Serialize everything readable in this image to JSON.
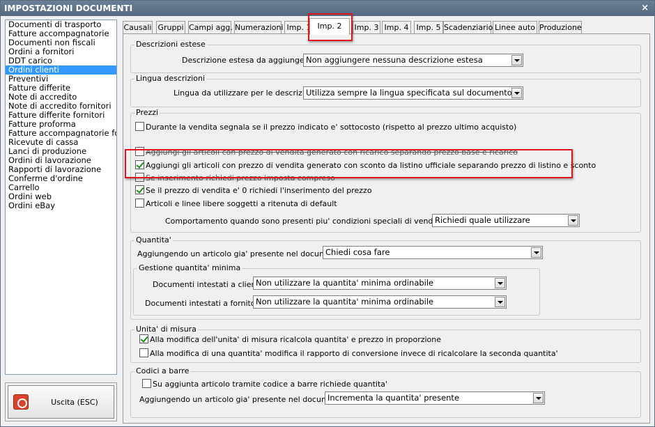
{
  "window": {
    "title": "IMPOSTAZIONI DOCUMENTI",
    "close_glyph": "×"
  },
  "doclist": [
    "Documenti di trasporto",
    "Fatture accompagnatorie",
    "Documenti non fiscali",
    "Ordini a fornitori",
    "DDT carico",
    "Ordini clienti",
    "Preventivi",
    "Fatture differite",
    "Note di accredito",
    "Note di accredito fornitori",
    "Fatture differite fornitori",
    "Fatture proforma",
    "Fatture accompagnatorie fc",
    "Ricevute di cassa",
    "Lanci di produzione",
    "Ordini di lavorazione",
    "Rapporti di lavorazione",
    "Conferme d'ordine",
    "Carrello",
    "Ordini web",
    "Ordini eBay"
  ],
  "doclist_selected": "Ordini clienti",
  "exit": {
    "label": "Uscita (ESC)",
    "icon": "power-icon"
  },
  "tabs": [
    "Causali",
    "Gruppi",
    "Campi agg.",
    "Numerazioni",
    "Imp. 1",
    "Imp. 2",
    "Imp. 3",
    "Imp. 4",
    "Imp. 5",
    "Scadenziario",
    "Linee auto",
    "Produzione"
  ],
  "active_tab": "Imp. 2",
  "descr": {
    "title": "Descrizioni estese",
    "label": "Descrizione estesa da aggiungere :",
    "value": "Non aggiungere nessuna descrizione estesa"
  },
  "lingua": {
    "title": "Lingua descrizioni",
    "label": "Lingua da utilizzare per le descrizioni :",
    "value": "Utilizza sempre la lingua specificata sul documento"
  },
  "prezzi": {
    "title": "Prezzi",
    "checks": [
      {
        "label": "Durante la vendita segnala se il prezzo indicato e' sottocosto (rispetto al prezzo ultimo acquisto)",
        "checked": false
      },
      {
        "label": "Aggiungi gli articoli con prezzo di vendita generato con ricarico separando prezzo base e ricarico",
        "checked": false
      },
      {
        "label": "Aggiungi gli articoli con prezzo di vendita generato con sconto da listino ufficiale separando prezzo di listino e sconto",
        "checked": true
      },
      {
        "label": "Se inserimento richiedi prezzo imposta compreso",
        "checked": false
      },
      {
        "label": "Se il prezzo di vendita e' 0 richiedi l'inserimento del prezzo",
        "checked": true
      },
      {
        "label": "Articoli e linee libere soggetti a ritenuta di default",
        "checked": false
      }
    ],
    "cond_label": "Comportamento quando sono presenti piu' condizioni speciali di vendita valide :",
    "cond_value": "Richiedi quale utilizzare"
  },
  "quantita": {
    "title": "Quantita'",
    "label": "Aggiungendo un articolo gia' presente nel documento :",
    "value": "Chiedi cosa fare",
    "minima": {
      "title": "Gestione quantita' minima",
      "clienti_label": "Documenti intestati a clienti :",
      "clienti_value": "Non utilizzare la quantita' minima ordinabile",
      "fornitori_label": "Documenti intestati a fornitori :",
      "fornitori_value": "Non utilizzare la quantita' minima ordinabile"
    }
  },
  "unita": {
    "title": "Unita' di misura",
    "checks": [
      {
        "label": "Alla modifica dell'unita' di misura ricalcola quantita' e prezzo in proporzione",
        "checked": true
      },
      {
        "label": "Alla modifica di una quantita' modifica il rapporto di conversione invece di ricalcolare la seconda quantita'",
        "checked": false
      }
    ]
  },
  "barre": {
    "title": "Codici a barre",
    "check": {
      "label": "Su aggiunta articolo tramite codice a barre richiede quantita'",
      "checked": false
    },
    "label": "Aggiungendo un articolo gia' presente nel documento :",
    "value": "Incrementa la quantita' presente"
  },
  "highlight_color": "#e0141e",
  "selection_color": "#3399ff"
}
